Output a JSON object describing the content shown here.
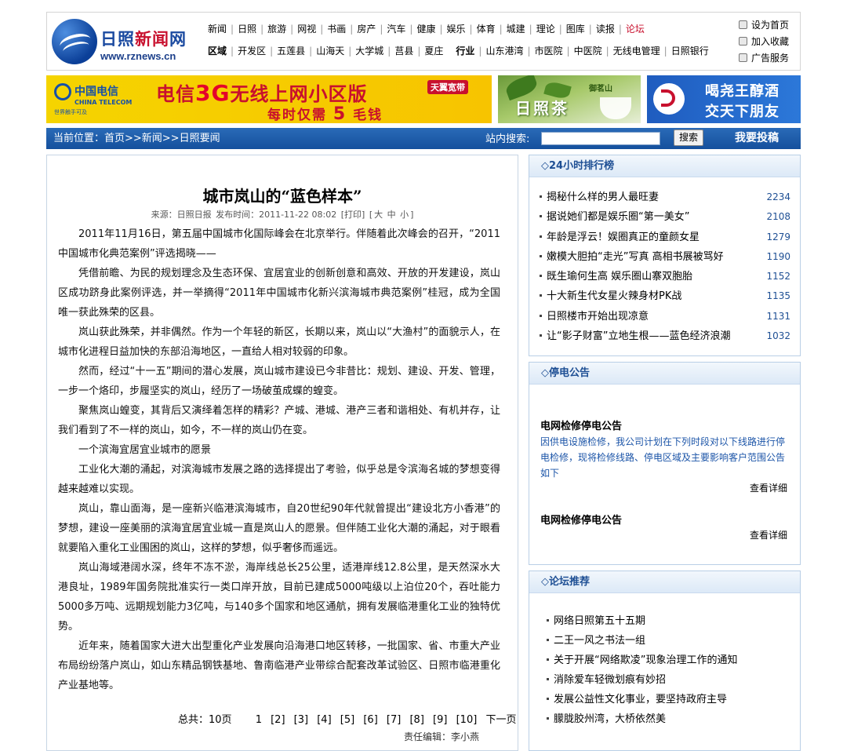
{
  "header": {
    "logo_cn_a": "日照",
    "logo_cn_b": "新闻",
    "logo_cn_c": "网",
    "logo_url": "www.rznews.cn",
    "nav_primary": [
      "新闻",
      "日照",
      "旅游",
      "网视",
      "书画",
      "房产",
      "汽车",
      "健康",
      "娱乐",
      "体育",
      "城建",
      "理论",
      "图库",
      "读报",
      "论坛"
    ],
    "nav_region_label": "区域",
    "nav_region": [
      "开发区",
      "五莲县",
      "山海天",
      "大学城",
      "莒县",
      "夏庄"
    ],
    "nav_industry_label": "行业",
    "nav_industry": [
      "山东港湾",
      "市医院",
      "中医院",
      "无线电管理",
      "日照银行"
    ],
    "quick_links": [
      "设为首页",
      "加入收藏",
      "广告服务"
    ]
  },
  "banners": {
    "telecom": {
      "brand_cn": "中国电信",
      "brand_en": "CHINA TELECOM",
      "slogan": "世界触手可及",
      "line1_a": "电信",
      "line1_b": "3G",
      "line1_c": "无线上网小区版",
      "line2_a": "每时仅需",
      "line2_b": "5",
      "line2_c": "毛钱",
      "tag": "天翼宽带"
    },
    "tea": {
      "title": "日照茶",
      "brand": "御茗山"
    },
    "wine": {
      "line1": "喝尧王醇酒",
      "line2": "交天下朋友"
    }
  },
  "locbar": {
    "location": "当前位置：首页>>新闻>>日照要闻",
    "search_label": "站内搜索:",
    "search_value": "",
    "search_button": "搜索",
    "submit": "我要投稿"
  },
  "article": {
    "title": "城市岚山的“蓝色样本”",
    "meta_source": "来源：日照日报",
    "meta_time": "发布时间：2011-11-22 08:02",
    "meta_print": "[打印]",
    "meta_size_open": "[",
    "meta_size_big": "大",
    "meta_size_mid": "中",
    "meta_size_small": "小",
    "meta_size_close": "]",
    "paragraphs": [
      "2011年11月16日，第五届中国城市化国际峰会在北京举行。伴随着此次峰会的召开，“2011中国城市化典范案例”评选揭晓——",
      "凭借前瞻、为民的规划理念及生态环保、宜居宜业的创新创意和高效、开放的开发建设，岚山区成功跻身此案例评选，并一举摘得“2011年中国城市化新兴滨海城市典范案例”桂冠，成为全国唯一获此殊荣的区县。",
      "岚山获此殊荣，并非偶然。作为一个年轻的新区，长期以来，岚山以“大渔村”的面貌示人，在城市化进程日益加快的东部沿海地区，一直给人相对较弱的印象。",
      "然而，经过“十一五”期间的潜心发展，岚山城市建设已今非昔比：规划、建设、开发、管理，一步一个烙印，步履坚实的岚山，经历了一场破茧成蝶的蝗变。",
      "聚焦岚山蝗变，其背后又演绎着怎样的精彩？产城、港城、港产三者和谐相处、有机并存，让我们看到了不一样的岚山，如今，不一样的岚山仍在变。",
      "一个滨海宜居宜业城市的愿景",
      "工业化大潮的涌起，对滨海城市发展之路的选择提出了考验，似乎总是令滨海名城的梦想变得越来越难以实现。",
      "岚山，靠山面海，是一座新兴临港滨海城市，自20世纪90年代就曾提出“建设北方小香港”的梦想，建设一座美丽的滨海宜居宜业城一直是岚山人的愿景。但伴随工业化大潮的涌起，对于眼看就要陷入重化工业围困的岚山，这样的梦想，似乎奢侈而遥远。",
      "岚山海域港阔水深，终年不冻不淤，海岸线总长25公里，适港岸线12.8公里，是天然深水大港良址，1989年国务院批准实行一类口岸开放，目前已建成5000吨级以上泊位20个，吞吐能力5000多万吨、远期规划能力3亿吨，与140多个国家和地区通航，拥有发展临港重化工业的独特优势。",
      "近年来，随着国家大进大出型重化产业发展向沿海港口地区转移，一批国家、省、市重大产业布局纷纷落户岚山，如山东精品钢铁基地、鲁南临港产业带综合配套改革试验区、日照市临港重化产业基地等。"
    ],
    "pager_total": "总共：10页",
    "pager_pages": [
      "1",
      "[2]",
      "[3]",
      "[4]",
      "[5]",
      "[6]",
      "[7]",
      "[8]",
      "[9]",
      "[10]"
    ],
    "pager_next": "下一页",
    "editor": "责任编辑：李小燕"
  },
  "rank": {
    "title": "◇24小时排行榜",
    "items": [
      {
        "text": "揭秘什么样的男人最旺妻",
        "count": "2234"
      },
      {
        "text": "据说她们都是娱乐圈“第一美女”",
        "count": "2108"
      },
      {
        "text": "年龄是浮云！娱圈真正的童颜女星",
        "count": "1279"
      },
      {
        "text": "嫩模大胆拍“走光”写真 高相书展被骂好",
        "count": "1190"
      },
      {
        "text": "既生瑜何生高 娱乐圈山寨双胞胎",
        "count": "1152"
      },
      {
        "text": "十大新生代女星火辣身材PK战",
        "count": "1135"
      },
      {
        "text": "日照楼市开始出现凉意",
        "count": "1131"
      },
      {
        "text": "让“影子财富”立地生根——蓝色经济浪潮",
        "count": "1032"
      }
    ]
  },
  "power": {
    "title": "◇停电公告",
    "notice1_title": "电网检修停电公告",
    "notice1_summary": "因供电设施检修，我公司计划在下列时段对以下线路进行停电检修，现将检修线路、停电区域及主要影响客户范围公告如下",
    "notice1_more": "查看详细",
    "notice2_title": "电网检修停电公告",
    "notice2_more": "查看详细"
  },
  "forum": {
    "title": "◇论坛推荐",
    "items": [
      "网络日照第五十五期",
      "二王一风之书法一组",
      "关于开展“网络欺凌”现象治理工作的通知",
      "消除爱车轻微划痕有妙招",
      "发展公益性文化事业，要坚持政府主导",
      "朦胧胶州湾，大桥依然美"
    ]
  }
}
